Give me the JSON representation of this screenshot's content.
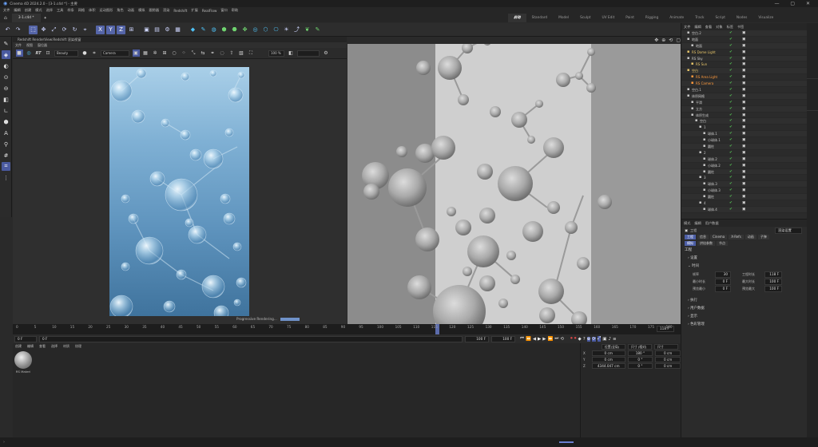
{
  "window": {
    "title": "Cinema 4D 2024.2.0 - [3-1.c4d *] - 主要",
    "doc_tab": "3-1.c4d *"
  },
  "menu": [
    "文件",
    "编辑",
    "创建",
    "模式",
    "选择",
    "工具",
    "样条",
    "网格",
    "体积",
    "运动图形",
    "角色",
    "动画",
    "模拟",
    "跟踪器",
    "渲染",
    "Redshift",
    "扩展",
    "RealFlow",
    "窗口",
    "帮助"
  ],
  "layouts": [
    "启动",
    "Standard",
    "Model",
    "Sculpt",
    "UV Edit",
    "Paint",
    "Rigging",
    "Animate",
    "Track",
    "Script",
    "Nodes",
    "Visualize"
  ],
  "render_view": {
    "title": "Redshift RenderView:Redshift 渲染视窗",
    "menu": [
      "文件",
      "视图",
      "窗位器"
    ],
    "rt": "RT",
    "beauty": "Beauty",
    "camera": "Camera",
    "scale": "100 %",
    "progress_text": "Progressive Rendering..."
  },
  "timeline": {
    "ticks": [
      "0",
      "5",
      "10",
      "15",
      "20",
      "25",
      "30",
      "35",
      "40",
      "45",
      "50",
      "55",
      "60",
      "65",
      "70",
      "75",
      "80",
      "85",
      "90",
      "95",
      "100",
      "105",
      "110",
      "115",
      "120",
      "125",
      "130",
      "135",
      "140",
      "145",
      "150",
      "155",
      "160",
      "165",
      "170",
      "175",
      "180"
    ],
    "end_field": "118 F",
    "start_f": "0 F",
    "current_f": "0 F",
    "end_f": "100 F",
    "end_f2": "100 F"
  },
  "material_panel": {
    "menu": [
      "创建",
      "编辑",
      "查看",
      "选择",
      "材质",
      "纹理"
    ],
    "material_name": "RS Materi"
  },
  "coordinates": {
    "headers": [
      "位置(全局)",
      "尺寸 (相对)",
      "尺寸"
    ],
    "rows": [
      {
        "axis": "X",
        "pos": "0 cm",
        "rot": "180 °",
        "size": "0 cm"
      },
      {
        "axis": "Y",
        "pos": "0 cm",
        "rot": "0 °",
        "size": "0 cm"
      },
      {
        "axis": "Z",
        "pos": "4344.047 cm",
        "rot": "0 °",
        "size": "0 cm"
      }
    ]
  },
  "objects": {
    "menu": [
      "文件",
      "编辑",
      "查看",
      "对象",
      "标签",
      "书签"
    ],
    "items": [
      {
        "name": "空白.2",
        "indent": 1,
        "color": "#c8c8c8"
      },
      {
        "name": "地面",
        "indent": 1,
        "color": "#c8c8c8"
      },
      {
        "name": "地面",
        "indent": 2,
        "color": "#c8c8c8"
      },
      {
        "name": "RS Dome Light",
        "indent": 1,
        "color": "#e8c66a"
      },
      {
        "name": "RS Sky",
        "indent": 1,
        "color": "#c8c8c8"
      },
      {
        "name": "RS Sun",
        "indent": 2,
        "color": "#e8c66a"
      },
      {
        "name": "空白",
        "indent": 1,
        "color": "#e8c66a"
      },
      {
        "name": "RS Area Light",
        "indent": 2,
        "color": "#ff9a3c"
      },
      {
        "name": "RS Camera",
        "indent": 2,
        "color": "#ff9a3c"
      },
      {
        "name": "空白.1",
        "indent": 1,
        "color": "#c8c8c8"
      },
      {
        "name": "体积网格",
        "indent": 1,
        "color": "#c8c8c8"
      },
      {
        "name": "平滑",
        "indent": 2,
        "color": "#c8c8c8"
      },
      {
        "name": "立方",
        "indent": 2,
        "color": "#c8c8c8"
      },
      {
        "name": "体积生成",
        "indent": 2,
        "color": "#c8c8c8"
      },
      {
        "name": "空白",
        "indent": 3,
        "color": "#c8c8c8"
      },
      {
        "name": "1",
        "indent": 4,
        "color": "#c8c8c8"
      },
      {
        "name": "球体.1",
        "indent": 5,
        "color": "#c8c8c8"
      },
      {
        "name": "小球体.1",
        "indent": 5,
        "color": "#c8c8c8"
      },
      {
        "name": "圆柱",
        "indent": 5,
        "color": "#c8c8c8"
      },
      {
        "name": "2",
        "indent": 4,
        "color": "#c8c8c8"
      },
      {
        "name": "球体.2",
        "indent": 5,
        "color": "#c8c8c8"
      },
      {
        "name": "小球体.2",
        "indent": 5,
        "color": "#c8c8c8"
      },
      {
        "name": "圆柱",
        "indent": 5,
        "color": "#c8c8c8"
      },
      {
        "name": "3",
        "indent": 4,
        "color": "#c8c8c8"
      },
      {
        "name": "球体.3",
        "indent": 5,
        "color": "#c8c8c8"
      },
      {
        "name": "小球体.3",
        "indent": 5,
        "color": "#c8c8c8"
      },
      {
        "name": "圆柱",
        "indent": 5,
        "color": "#c8c8c8"
      },
      {
        "name": "4",
        "indent": 4,
        "color": "#c8c8c8"
      },
      {
        "name": "球体.4",
        "indent": 5,
        "color": "#c8c8c8"
      }
    ]
  },
  "attributes": {
    "menu": [
      "模式",
      "编辑",
      "用户数据"
    ],
    "project_label": "工程",
    "dropdown": "渲染设置",
    "tabs": [
      "工程",
      "信息",
      "Cinema",
      "X-Refs",
      "动画",
      "子弹"
    ],
    "tabs2": [
      "模拟",
      "烘焙参数",
      "节点"
    ],
    "section_title": "工程",
    "sec_settings": "设置",
    "sec_time": "时间",
    "fields": [
      {
        "label": "帧率",
        "value": "30",
        "label2": "工程时长",
        "value2": "118 F"
      },
      {
        "label": "最小时长",
        "value": "0 F",
        "label2": "最大时长",
        "value2": "100 F"
      },
      {
        "label": "预览最小",
        "value": "0 F",
        "label2": "预览最大",
        "value2": "100 F"
      }
    ],
    "more_sections": [
      "执行",
      "用户数据",
      "显示",
      "色彩管理"
    ]
  },
  "colors": {
    "accent": "#5565a8",
    "check": "#56c256",
    "light_tag": "#e8c66a"
  }
}
